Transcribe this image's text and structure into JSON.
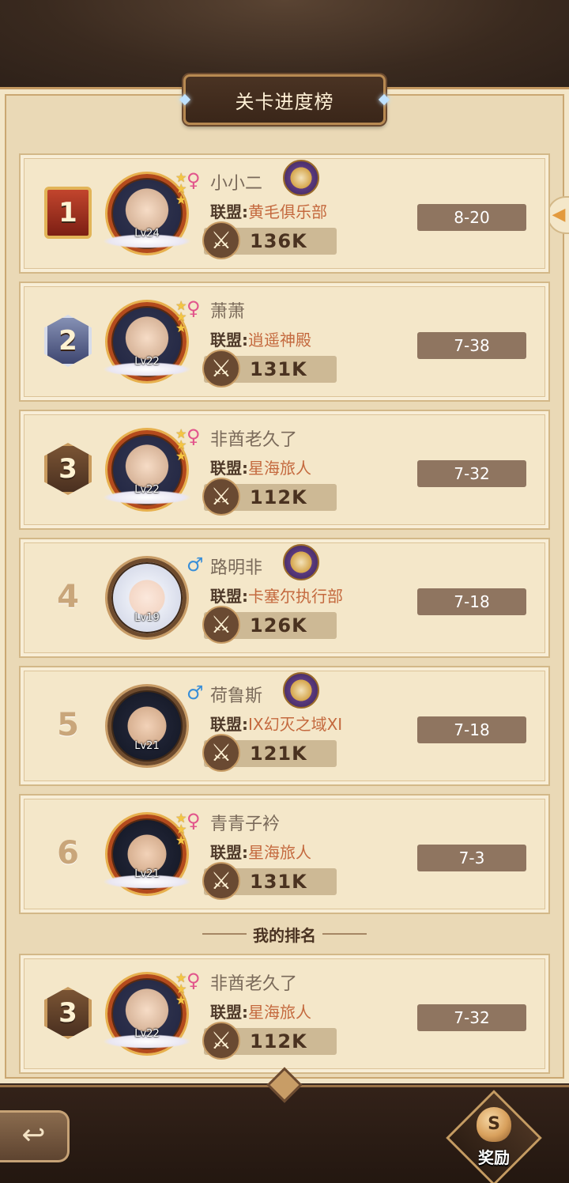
{
  "header": {
    "title": "关卡进度榜"
  },
  "labels": {
    "alliance_label": "联盟:",
    "my_rank": "我的排名",
    "reward": "奖励"
  },
  "colors": {
    "female": "#e2558c",
    "male": "#3a8fd8",
    "alliance_value": "#c4693e",
    "stage_bg": "#8f7560"
  },
  "rows": [
    {
      "rank": "1",
      "name": "小小二",
      "gender": "female",
      "level": "Lv24",
      "alliance": "黄毛俱乐部",
      "power": "136K",
      "stage": "8-20"
    },
    {
      "rank": "2",
      "name": "萧萧",
      "gender": "female",
      "level": "Lv22",
      "alliance": "逍遥神殿",
      "power": "131K",
      "stage": "7-38"
    },
    {
      "rank": "3",
      "name": "非酋老久了",
      "gender": "female",
      "level": "Lv22",
      "alliance": "星海旅人",
      "power": "112K",
      "stage": "7-32"
    },
    {
      "rank": "4",
      "name": "路明非",
      "gender": "male",
      "level": "Lv19",
      "alliance": "卡塞尔执行部",
      "power": "126K",
      "stage": "7-18"
    },
    {
      "rank": "5",
      "name": "荷鲁斯",
      "gender": "male",
      "level": "Lv21",
      "alliance": "IX幻灭之域XI",
      "power": "121K",
      "stage": "7-18"
    },
    {
      "rank": "6",
      "name": "青青子衿",
      "gender": "female",
      "level": "Lv21",
      "alliance": "星海旅人",
      "power": "131K",
      "stage": "7-3"
    }
  ],
  "my_row": {
    "rank": "3",
    "name": "非酋老久了",
    "gender": "female",
    "level": "Lv22",
    "alliance": "星海旅人",
    "power": "112K",
    "stage": "7-32"
  },
  "icons": {
    "female": "♀",
    "male": "♂",
    "sword": "⚔",
    "back": "↩",
    "side_arrow": "◀",
    "reward": "S",
    "stars": "★"
  }
}
